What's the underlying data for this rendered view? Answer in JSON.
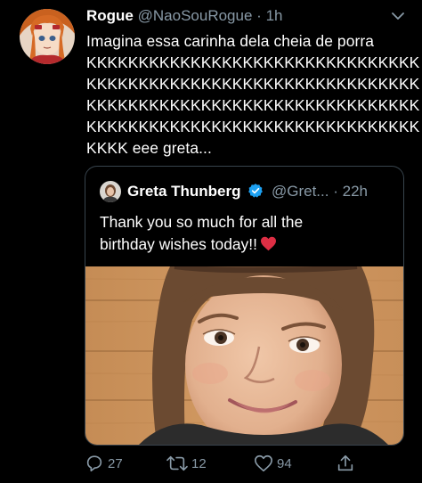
{
  "tweet": {
    "author_name": "Rogue",
    "author_handle": "@NaoSouRogue",
    "separator": "·",
    "time": "1h",
    "text_lines": [
      "Imagina essa carinha dela cheia de porra",
      "KKKKKKKKKKKKKKKKKKKKKKKKKKKKKKKK",
      "KKKKKKKKKKKKKKKKKKKKKKKKKKKKKKKK",
      "KKKKKKKKKKKKKKKKKKKKKKKKKKKKKKKK",
      "KKKKKKKKKKKKKKKKKKKKKKKKKKKKKKKK",
      "KKKK eee greta..."
    ]
  },
  "quoted": {
    "author_name": "Greta Thunberg",
    "author_handle": "@Gret...",
    "separator": "·",
    "time": "22h",
    "text_lines": [
      "Thank you so much for all the",
      "birthday wishes today!!"
    ],
    "emoji": "red-heart-emoji",
    "verified_icon": "verified-badge-icon"
  },
  "actions": {
    "reply_count": "27",
    "retweet_count": "12",
    "like_count": "94"
  },
  "colors": {
    "background": "#000000",
    "secondary_text": "#8899a6",
    "border": "#38444d",
    "verified": "#1da1f2",
    "heart": "#e0245e"
  },
  "icons": [
    "chevron-down-icon",
    "reply-icon",
    "retweet-icon",
    "like-icon",
    "share-icon"
  ]
}
